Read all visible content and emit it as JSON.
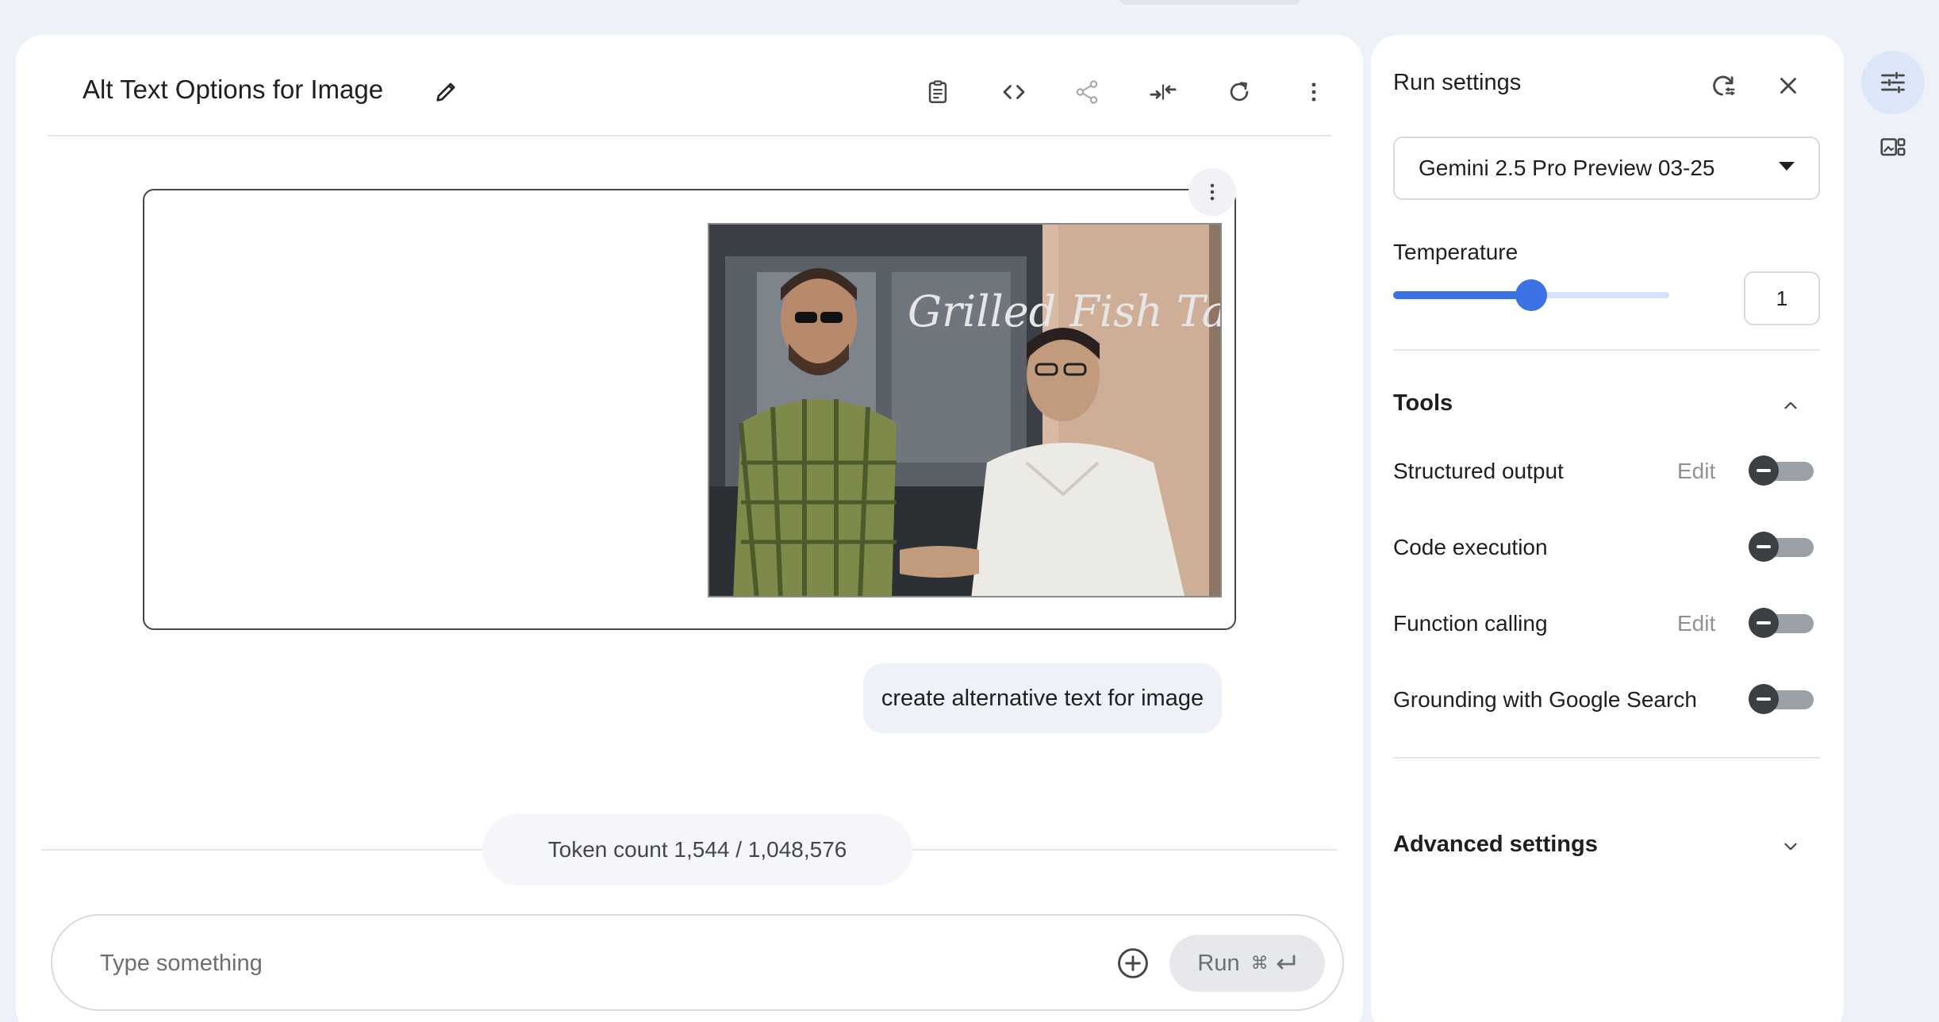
{
  "prompt": {
    "title": "Alt Text Options for Image",
    "image_caption_text": "Grilled Fish Tacos",
    "user_message": "create alternative text for image",
    "token_count": "Token count 1,544 / 1,048,576"
  },
  "composer": {
    "placeholder": "Type something",
    "run_label": "Run",
    "run_shortcut": "⌘"
  },
  "settings": {
    "title": "Run settings",
    "model": "Gemini 2.5 Pro Preview 03-25",
    "temperature_label": "Temperature",
    "temperature_value": "1",
    "temperature_fraction": 0.5,
    "tools_label": "Tools",
    "tools": [
      {
        "label": "Structured output",
        "edit": "Edit",
        "enabled": false
      },
      {
        "label": "Code execution",
        "edit": "",
        "enabled": false
      },
      {
        "label": "Function calling",
        "edit": "Edit",
        "enabled": false
      },
      {
        "label": "Grounding with Google Search",
        "edit": "",
        "enabled": false
      }
    ],
    "advanced_label": "Advanced settings"
  },
  "colors": {
    "accent": "#3b73e5",
    "background": "#eef2f8"
  }
}
